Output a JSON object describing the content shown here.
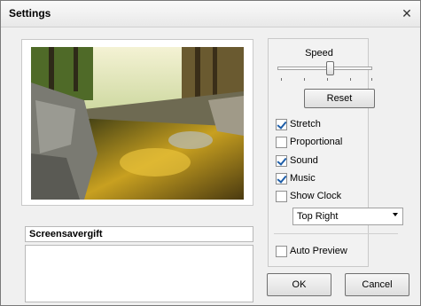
{
  "window": {
    "title": "Settings",
    "close_glyph": "✕"
  },
  "preview": {
    "image_name": "river-forest-hdr-preview"
  },
  "name_field": {
    "value": "Screensavergift"
  },
  "description_field": {
    "value": ""
  },
  "speed": {
    "label": "Speed",
    "value_fraction": 0.6
  },
  "reset_label": "Reset",
  "options": {
    "stretch": {
      "label": "Stretch",
      "checked": true
    },
    "proportional": {
      "label": "Proportional",
      "checked": false
    },
    "sound": {
      "label": "Sound",
      "checked": true
    },
    "music": {
      "label": "Music",
      "checked": true
    },
    "show_clock": {
      "label": "Show Clock",
      "checked": false
    },
    "auto_preview": {
      "label": "Auto Preview",
      "checked": false
    }
  },
  "clock_position": {
    "selected": "Top Right"
  },
  "buttons": {
    "ok": "OK",
    "cancel": "Cancel"
  },
  "colors": {
    "check_mark": "#1d5da8",
    "window_bg": "#f0f0f0"
  }
}
